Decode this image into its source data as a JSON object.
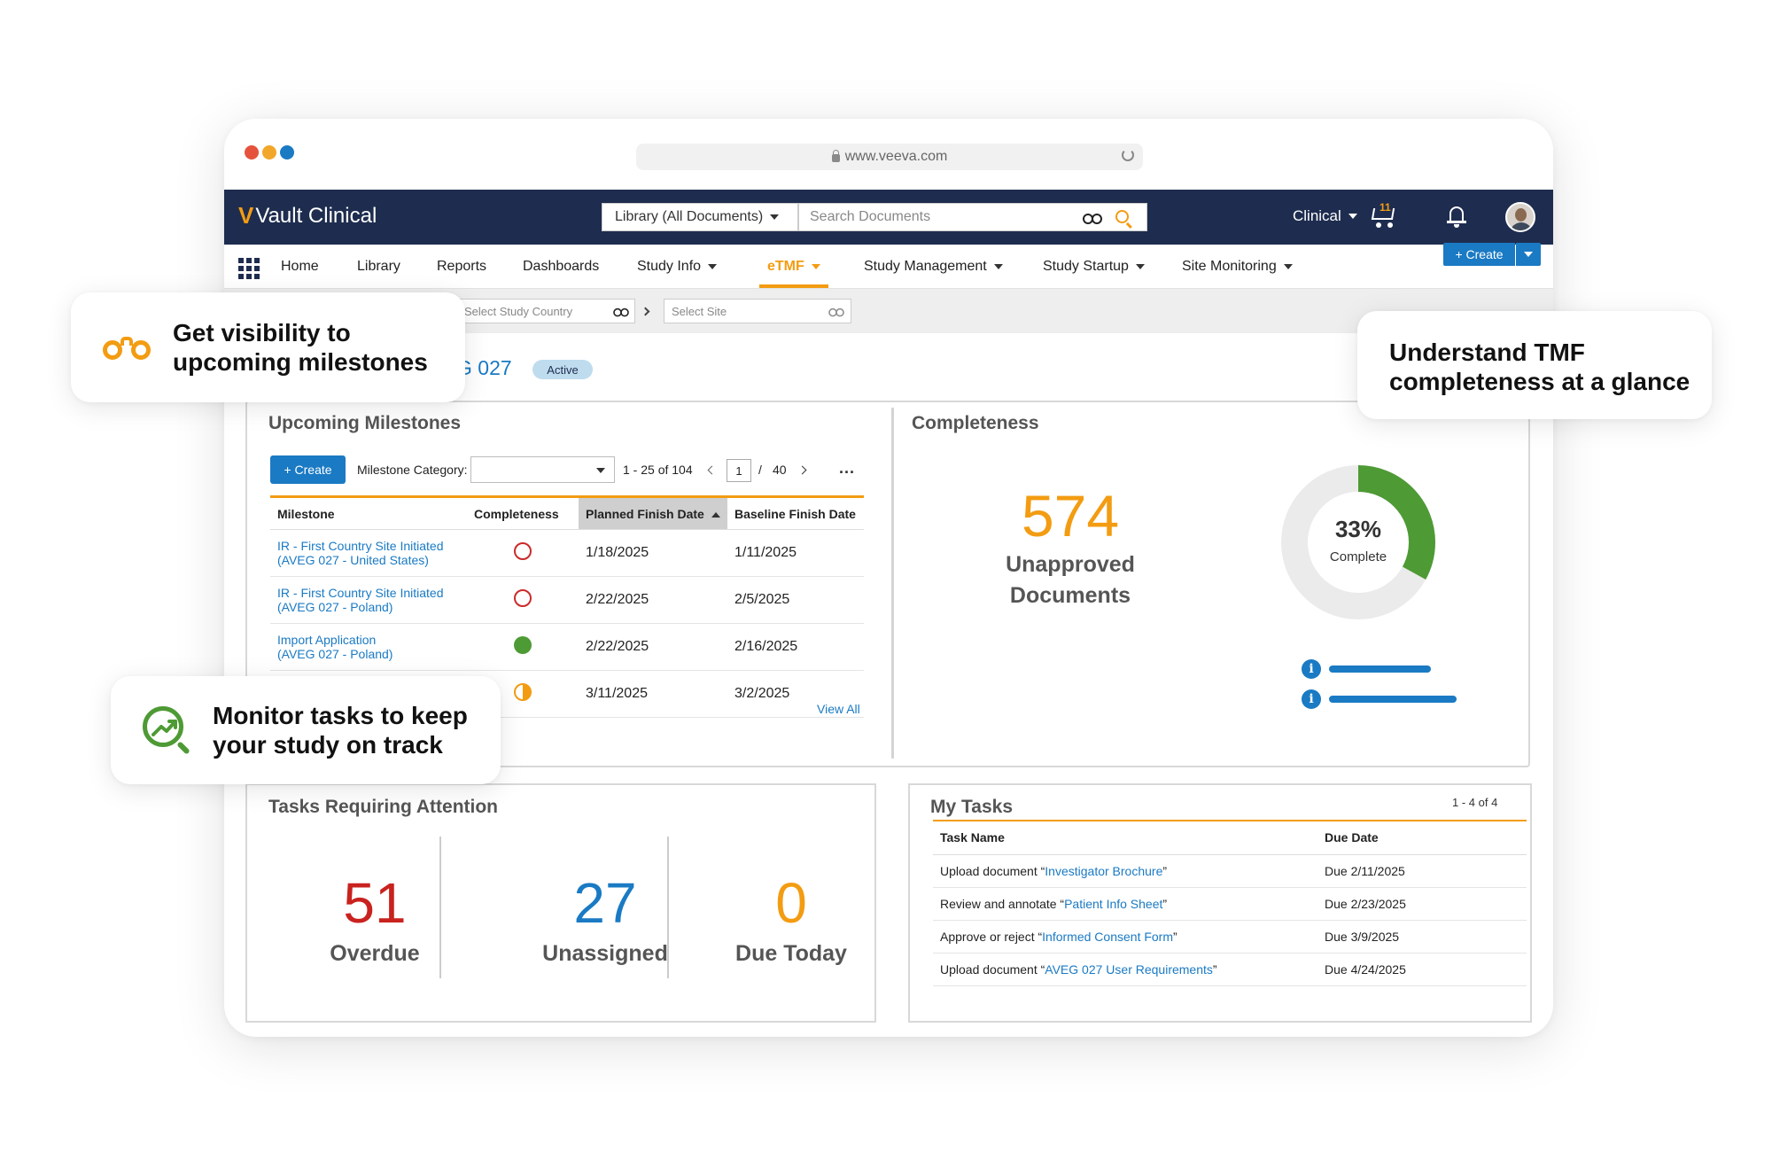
{
  "browser": {
    "url": "www.veeva.com",
    "dot_colors": [
      "#e5533d",
      "#f2a72a",
      "#1a7ac4"
    ]
  },
  "app": {
    "logo_text": "Vault Clinical",
    "library_select": "Library (All Documents)",
    "search_placeholder": "Search Documents",
    "workspace_menu": "Clinical",
    "cart_count": "11"
  },
  "nav": {
    "items": [
      "Home",
      "Library",
      "Reports",
      "Dashboards",
      "Study Info",
      "eTMF",
      "Study Management",
      "Study Startup",
      "Site Monitoring"
    ],
    "active": "eTMF",
    "create_label": "+ Create"
  },
  "filters": {
    "country_placeholder": "Select Study Country",
    "site_placeholder": "Select Site"
  },
  "study": {
    "title_fragment": "G 027",
    "status": "Active"
  },
  "milestones": {
    "title": "Upcoming Milestones",
    "create_label": "+ Create",
    "category_label": "Milestone Category:",
    "range_text": "1 - 25 of 104",
    "page": "1",
    "page_sep": "/",
    "total_pages": "40",
    "more": "...",
    "columns": [
      "Milestone",
      "Completeness",
      "Planned Finish Date",
      "Baseline Finish Date"
    ],
    "rows": [
      {
        "name_line1": "IR - First Country Site Initiated",
        "name_line2": "(AVEG 027 - United States)",
        "status": "not-started",
        "planned": "1/18/2025",
        "baseline": "1/11/2025"
      },
      {
        "name_line1": "IR - First Country Site Initiated",
        "name_line2": "(AVEG 027 - Poland)",
        "status": "not-started",
        "planned": "2/22/2025",
        "baseline": "2/5/2025"
      },
      {
        "name_line1": "Import Application",
        "name_line2": "(AVEG 027 - Poland)",
        "status": "complete",
        "planned": "2/22/2025",
        "baseline": "2/16/2025"
      },
      {
        "name_line1": "",
        "name_line2": "",
        "status": "in-progress",
        "planned": "3/11/2025",
        "baseline": "3/2/2025"
      }
    ],
    "view_all": "View All"
  },
  "completeness": {
    "title": "Completeness",
    "unapproved_count": "574",
    "unapproved_label_1": "Unapproved",
    "unapproved_label_2": "Documents",
    "percent_label": "33%",
    "percent_value": 0.33,
    "complete_label": "Complete",
    "colors": {
      "complete": "#4e9a35",
      "remaining": "#ebebeb",
      "accent": "#f39c12"
    }
  },
  "tasks_attention": {
    "title": "Tasks Requiring Attention",
    "overdue_count": "51",
    "overdue_label": "Overdue",
    "unassigned_count": "27",
    "unassigned_label": "Unassigned",
    "due_today_count": "0",
    "due_today_label": "Due Today",
    "colors": {
      "overdue": "#c9221f",
      "unassigned": "#1a7ac4",
      "due_today": "#f39c12"
    }
  },
  "my_tasks": {
    "title": "My Tasks",
    "count_text": "1 - 4 of 4",
    "columns": [
      "Task Name",
      "Due Date"
    ],
    "rows": [
      {
        "prefix": "Upload document “",
        "link": "Investigator Brochure",
        "suffix": "”",
        "due": "Due 2/11/2025"
      },
      {
        "prefix": "Review and annotate “",
        "link": "Patient Info Sheet",
        "suffix": "”",
        "due": "Due 2/23/2025"
      },
      {
        "prefix": "Approve or reject “",
        "link": "Informed Consent Form",
        "suffix": "”",
        "due": "Due 3/9/2025"
      },
      {
        "prefix": "Upload document “",
        "link": "AVEG 027 User Requirements",
        "suffix": "”",
        "due": "Due 4/24/2025"
      }
    ]
  },
  "callouts": {
    "milestones_line1": "Get visibility to",
    "milestones_line2": "upcoming milestones",
    "tmf_line1": "Understand TMF",
    "tmf_line2": "completeness at a glance",
    "tasks_line1": "Monitor tasks to keep",
    "tasks_line2": "your study on track"
  },
  "icons": [
    "lock-icon",
    "reload-icon",
    "binoculars-icon",
    "search-icon",
    "cart-icon",
    "bell-icon",
    "avatar",
    "app-grid-icon",
    "info-icon",
    "magnifier-chart-icon"
  ]
}
